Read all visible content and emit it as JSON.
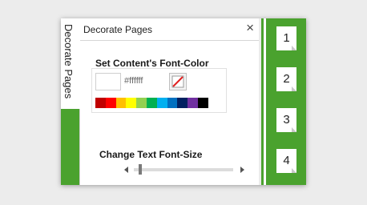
{
  "tabs": [
    {
      "label": "Decorate Pages"
    }
  ],
  "panel": {
    "title": "Decorate Pages",
    "close_icon": "×"
  },
  "font_color": {
    "title": "Set Content's Font-Color",
    "hex_value": "#ffffff",
    "current_color": "#ffffff",
    "palette": [
      "#c00000",
      "#ff0000",
      "#ffc000",
      "#ffff00",
      "#92d050",
      "#00b050",
      "#00b0f0",
      "#0070c0",
      "#002060",
      "#7030a0",
      "#000000"
    ]
  },
  "font_size": {
    "title": "Change Text Font-Size",
    "level": 0.05
  },
  "pages": [
    {
      "label": "1"
    },
    {
      "label": "2"
    },
    {
      "label": "3"
    },
    {
      "label": "4"
    }
  ],
  "colors": {
    "accent": "#4aa22e"
  }
}
